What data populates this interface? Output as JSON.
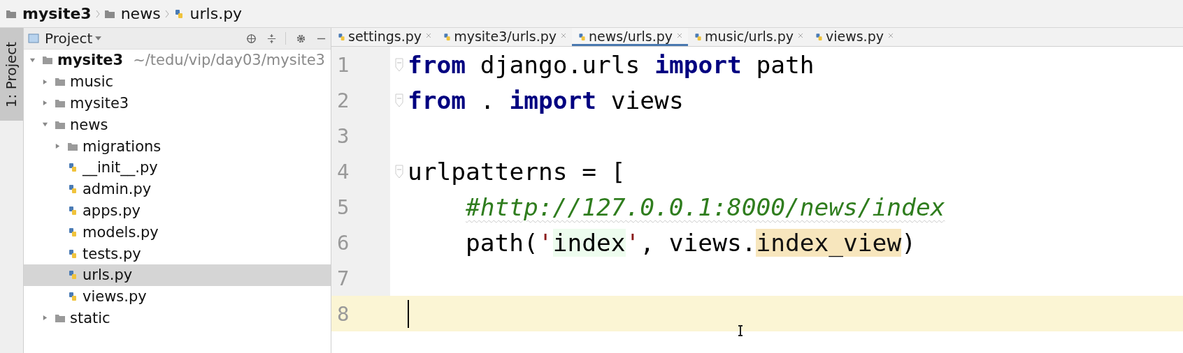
{
  "breadcrumb": [
    {
      "label": "mysite3",
      "kind": "folder",
      "bold": true
    },
    {
      "label": "news",
      "kind": "folder",
      "bold": false
    },
    {
      "label": "urls.py",
      "kind": "python",
      "bold": false
    }
  ],
  "tool_stripe": {
    "top": "1: Project"
  },
  "project_panel": {
    "title": "Project",
    "tree": [
      {
        "label": "mysite3",
        "hint": "~/tedu/vip/day03/mysite3",
        "kind": "folder",
        "bold": true,
        "expanded": true,
        "selected": false,
        "children": [
          {
            "label": "music",
            "kind": "folder",
            "expanded": false,
            "selected": false
          },
          {
            "label": "mysite3",
            "kind": "folder",
            "expanded": false,
            "selected": false
          },
          {
            "label": "news",
            "kind": "folder",
            "expanded": true,
            "selected": false,
            "children": [
              {
                "label": "migrations",
                "kind": "folder",
                "expanded": false,
                "selected": false
              },
              {
                "label": "__init__.py",
                "kind": "python",
                "selected": false
              },
              {
                "label": "admin.py",
                "kind": "python",
                "selected": false
              },
              {
                "label": "apps.py",
                "kind": "python",
                "selected": false
              },
              {
                "label": "models.py",
                "kind": "python",
                "selected": false
              },
              {
                "label": "tests.py",
                "kind": "python",
                "selected": false
              },
              {
                "label": "urls.py",
                "kind": "python",
                "selected": true
              },
              {
                "label": "views.py",
                "kind": "python",
                "selected": false
              }
            ]
          },
          {
            "label": "static",
            "kind": "folder",
            "expanded": false,
            "selected": false
          }
        ]
      }
    ]
  },
  "tabs": [
    {
      "label": "settings.py",
      "selected": false
    },
    {
      "label": "mysite3/urls.py",
      "selected": false
    },
    {
      "label": "news/urls.py",
      "selected": true
    },
    {
      "label": "music/urls.py",
      "selected": false
    },
    {
      "label": "views.py",
      "selected": false
    }
  ],
  "editor": {
    "lines": [
      {
        "number": "1",
        "current": false,
        "fold": true,
        "tokens": [
          {
            "kind": "keyword",
            "text": "from"
          },
          {
            "kind": "plain",
            "text": " django.urls "
          },
          {
            "kind": "keyword",
            "text": "import"
          },
          {
            "kind": "plain",
            "text": " path"
          }
        ]
      },
      {
        "number": "2",
        "current": false,
        "fold": true,
        "tokens": [
          {
            "kind": "keyword",
            "text": "from"
          },
          {
            "kind": "plain",
            "text": " . "
          },
          {
            "kind": "keyword",
            "text": "import"
          },
          {
            "kind": "plain",
            "text": " views"
          }
        ]
      },
      {
        "number": "3",
        "current": false,
        "fold": false
      },
      {
        "number": "4",
        "current": false,
        "fold": true,
        "tokens": [
          {
            "kind": "plain",
            "text": "urlpatterns = ["
          }
        ]
      },
      {
        "number": "5",
        "current": false,
        "fold": false,
        "indented": true,
        "tokens": [
          {
            "kind": "comment",
            "text": "#http://127.0.0.1:8000/news/index"
          }
        ]
      },
      {
        "number": "6",
        "current": false,
        "fold": false,
        "indented": true,
        "tokens": [
          {
            "kind": "plain",
            "text": "path("
          },
          {
            "kind": "quote",
            "text": "'"
          },
          {
            "kind": "string",
            "text": "index"
          },
          {
            "kind": "quote",
            "text": "'"
          },
          {
            "kind": "plain",
            "text": ", views."
          },
          {
            "kind": "usage",
            "text": "index_view"
          },
          {
            "kind": "plain",
            "text": ")"
          }
        ]
      },
      {
        "number": "7",
        "current": false,
        "fold": false
      },
      {
        "number": "8",
        "current": true,
        "fold": false
      }
    ]
  }
}
